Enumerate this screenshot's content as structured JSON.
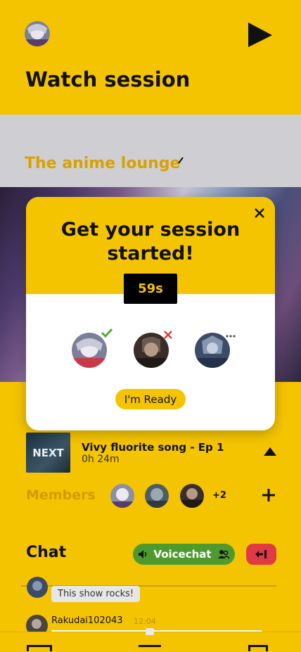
{
  "header": {
    "title": "Watch session"
  },
  "lounge": {
    "title": "The anime lounge"
  },
  "modal": {
    "title": "Get your session started!",
    "timer": "59s",
    "ready_label": "I'm Ready",
    "participants": [
      {
        "status": "ready",
        "status_icon": "check-icon"
      },
      {
        "status": "declined",
        "status_icon": "x-icon"
      },
      {
        "status": "pending",
        "status_icon": "ellipsis-icon"
      }
    ]
  },
  "next_up": {
    "thumb_label": "NEXT",
    "title": "Vivy fluorite song - Ep 1",
    "duration": "0h 24m"
  },
  "members": {
    "label": "Members",
    "extra_count": "+2"
  },
  "chat": {
    "title": "Chat",
    "voicechat_label": "Voicechat",
    "messages": [
      {
        "text": "This show rocks!"
      },
      {
        "user": "Rakudai102043",
        "time": "12:04"
      }
    ]
  },
  "colors": {
    "accent": "#f5c400",
    "voice": "#4f9a2f",
    "leave": "#e23a45"
  }
}
